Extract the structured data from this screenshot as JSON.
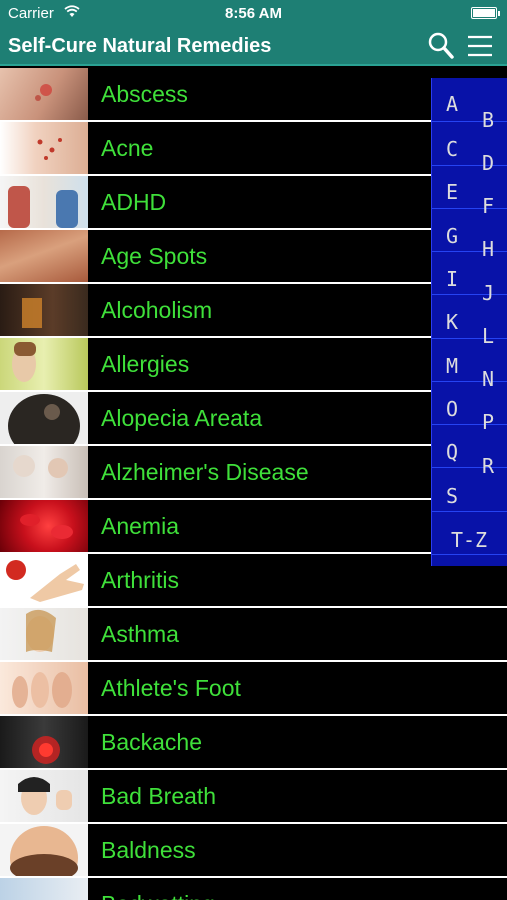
{
  "status_bar": {
    "carrier": "Carrier",
    "time": "8:56 AM"
  },
  "nav": {
    "title": "Self-Cure Natural Remedies",
    "search_icon": "search-icon",
    "menu_icon": "menu-icon"
  },
  "colors": {
    "bar": "#1e7f74",
    "label": "#3fe03a",
    "index_bg": "#0812a8"
  },
  "items": [
    {
      "label": "Abscess"
    },
    {
      "label": "Acne"
    },
    {
      "label": "ADHD"
    },
    {
      "label": "Age Spots"
    },
    {
      "label": "Alcoholism"
    },
    {
      "label": "Allergies"
    },
    {
      "label": "Alopecia Areata"
    },
    {
      "label": "Alzheimer's Disease"
    },
    {
      "label": "Anemia"
    },
    {
      "label": "Arthritis"
    },
    {
      "label": "Asthma"
    },
    {
      "label": "Athlete's Foot"
    },
    {
      "label": "Backache"
    },
    {
      "label": "Bad Breath"
    },
    {
      "label": "Baldness"
    },
    {
      "label": "Bedwetting"
    }
  ],
  "index_letters": [
    "A",
    "B",
    "C",
    "D",
    "E",
    "F",
    "G",
    "H",
    "I",
    "J",
    "K",
    "L",
    "M",
    "N",
    "O",
    "P",
    "Q",
    "R",
    "S",
    "T-Z"
  ]
}
